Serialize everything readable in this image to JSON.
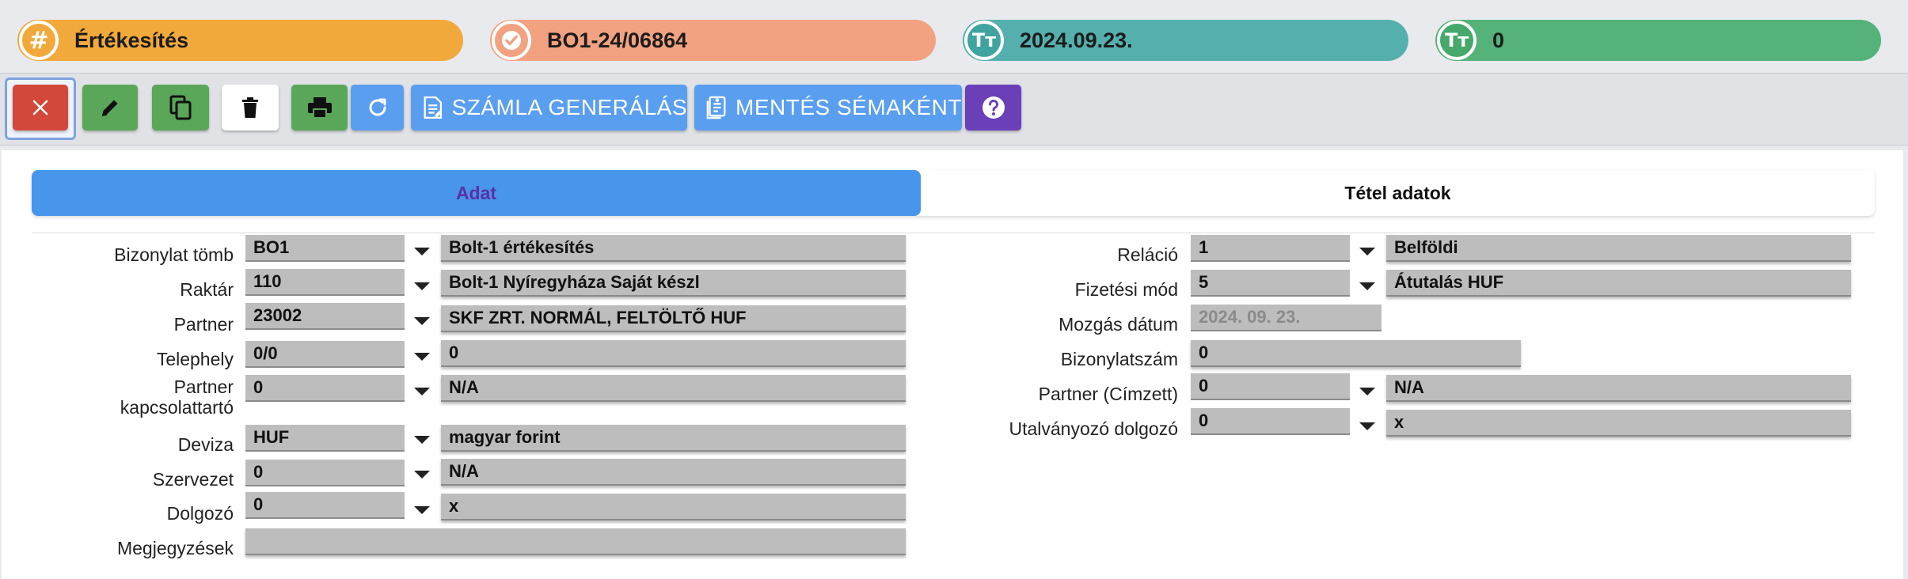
{
  "header": {
    "type": {
      "icon": "hash-icon",
      "value": "Értékesítés",
      "color": "#f2a93b",
      "icon_color": "#f2a93b"
    },
    "document": {
      "icon": "check-badge-icon",
      "value": "BO1-24/06864",
      "color": "#f2a281",
      "icon_color": "#f2a281"
    },
    "date": {
      "icon": "text-icon",
      "value": "2024.09.23.",
      "color": "#55b0ad",
      "icon_color": "#3fa3a0"
    },
    "count": {
      "icon": "text-icon",
      "value": "0",
      "color": "#55b37a",
      "icon_color": "#46a86b"
    }
  },
  "toolbar": {
    "close": {
      "icon": "close-icon",
      "color": "#d2483a"
    },
    "edit": {
      "icon": "pencil-icon",
      "color": "#5aa75a"
    },
    "copy": {
      "icon": "copy-icon",
      "color": "#5aa75a"
    },
    "delete": {
      "icon": "trash-icon",
      "color": "#ffffff"
    },
    "print": {
      "icon": "printer-icon",
      "color": "#5aa75a"
    },
    "refresh": {
      "icon": "refresh-icon",
      "color": "#5a9ef0"
    },
    "generate_invoice": {
      "icon": "invoice-icon",
      "label": "SZÁMLA GENERÁLÁS",
      "color": "#5a9ef0"
    },
    "save_as_template": {
      "icon": "template-icon",
      "label": "MENTÉS SÉMAKÉNT",
      "color": "#5a9ef0"
    },
    "help": {
      "icon": "help-icon",
      "color": "#6a3fb8"
    }
  },
  "tabs": {
    "active": "Adat",
    "other": "Tétel adatok"
  },
  "form_left": [
    {
      "label": "Bizonylat tömb",
      "code": "BO1",
      "name": "Bolt-1 értékesítés"
    },
    {
      "label": "Raktár",
      "code": "110",
      "name": "Bolt-1 Nyíregyháza Saját készl"
    },
    {
      "label": "Partner",
      "code": "23002",
      "name": "SKF ZRT. NORMÁL, FELTÖLTŐ HUF"
    },
    {
      "label": "Telephely",
      "code": "0/0",
      "name": "0"
    },
    {
      "label": "Partner kapcsolattartó",
      "code": "0",
      "name": "N/A"
    },
    {
      "label": "Deviza",
      "code": "HUF",
      "name": "magyar forint"
    },
    {
      "label": "Szervezet",
      "code": "0",
      "name": "N/A"
    },
    {
      "label": "Dolgozó",
      "code": "0",
      "name": "x"
    },
    {
      "label": "Megjegyzések",
      "value": ""
    }
  ],
  "form_right": [
    {
      "label": "Reláció",
      "code": "1",
      "name": "Belföldi"
    },
    {
      "label": "Fizetési mód",
      "code": "5",
      "name": "Átutalás HUF"
    },
    {
      "label": "Mozgás dátum",
      "value": "2024. 09. 23."
    },
    {
      "label": "Bizonylatszám",
      "value": "0"
    },
    {
      "label": "Partner (Címzett)",
      "code": "0",
      "name": "N/A"
    },
    {
      "label": "Utalványozó dolgozó",
      "code": "0",
      "name": "x"
    }
  ]
}
